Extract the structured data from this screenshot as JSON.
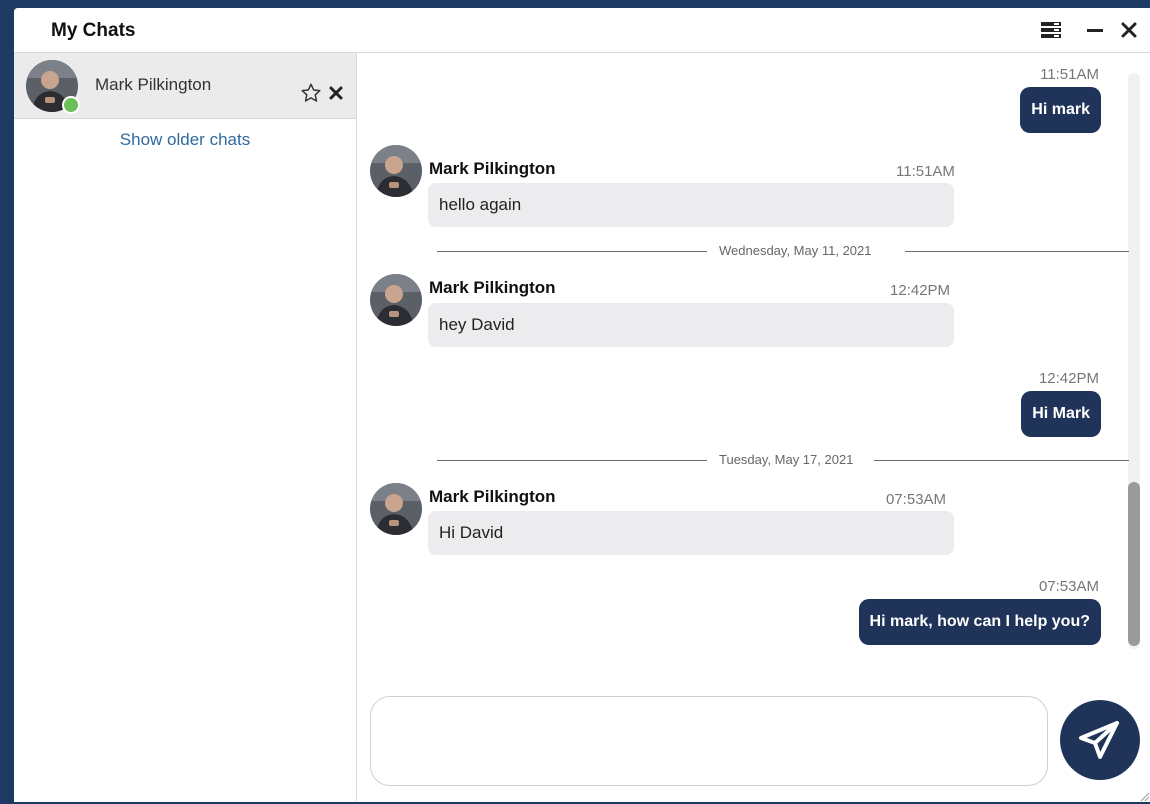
{
  "window": {
    "title": "My Chats"
  },
  "sidebar": {
    "chat_items": [
      {
        "name": "Mark Pilkington",
        "status": "online"
      }
    ],
    "older_link": "Show older chats"
  },
  "messages": {
    "m1": {
      "time": "11:51AM",
      "text": "Hi mark"
    },
    "m2": {
      "sender": "Mark Pilkington",
      "time": "11:51AM",
      "text": "hello again"
    },
    "d1": {
      "label": "Wednesday, May 11, 2021"
    },
    "m3": {
      "sender": "Mark Pilkington",
      "time": "12:42PM",
      "text": "hey David"
    },
    "m4": {
      "time": "12:42PM",
      "text": "Hi Mark"
    },
    "d2": {
      "label": "Tuesday, May 17, 2021"
    },
    "m5": {
      "sender": "Mark Pilkington",
      "time": "07:53AM",
      "text": "Hi David"
    },
    "m6": {
      "time": "07:53AM",
      "text": "Hi mark, how can I help you?"
    }
  },
  "compose": {
    "value": "",
    "placeholder": ""
  },
  "colors": {
    "brand_navy": "#1f3458",
    "online_green": "#6cc05a",
    "incoming_bubble": "#ececef",
    "link_blue": "#2f6a9e"
  },
  "icons": {
    "menu": "menu-icon",
    "minimize": "minimize-icon",
    "close": "close-icon",
    "star": "star-outline-icon",
    "remove": "close-icon",
    "send": "paper-plane-icon"
  }
}
